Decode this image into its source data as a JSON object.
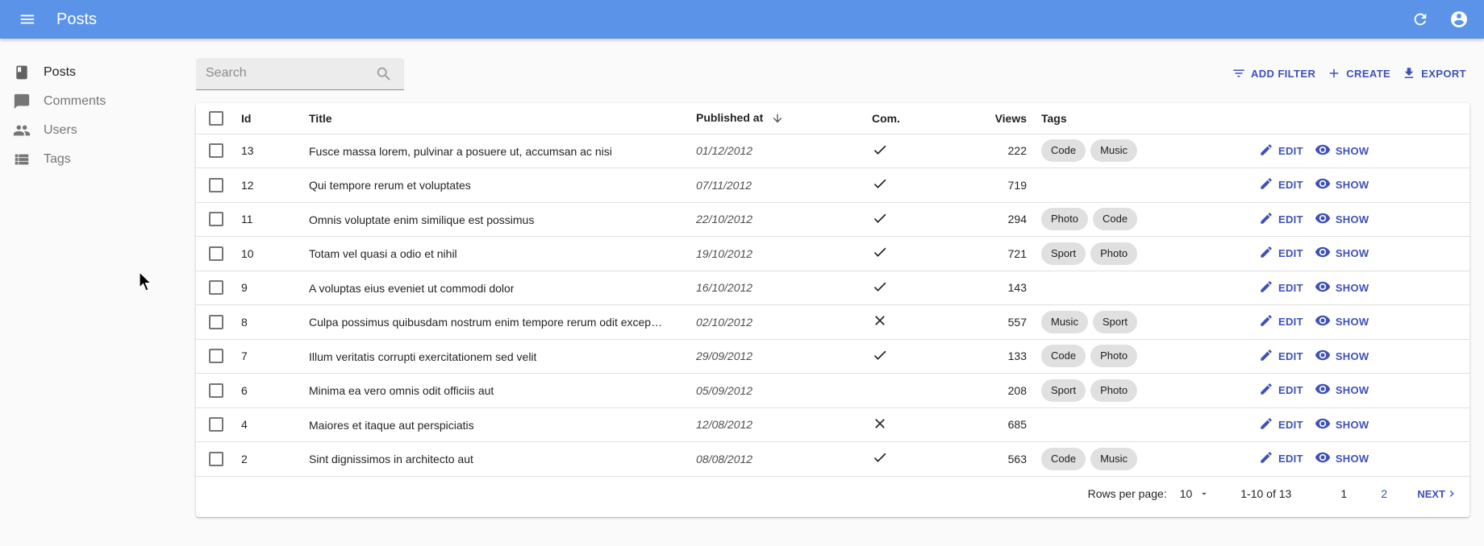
{
  "appbar": {
    "title": "Posts",
    "accent": "#5a93e8"
  },
  "sidebar": {
    "items": [
      {
        "label": "Posts",
        "icon": "book-icon"
      },
      {
        "label": "Comments",
        "icon": "comment-icon"
      },
      {
        "label": "Users",
        "icon": "people-icon"
      },
      {
        "label": "Tags",
        "icon": "list-icon"
      }
    ]
  },
  "search": {
    "placeholder": "Search",
    "value": ""
  },
  "toolbar": {
    "add_filter": "ADD FILTER",
    "create": "CREATE",
    "export": "EXPORT"
  },
  "table": {
    "headers": {
      "id": "Id",
      "title": "Title",
      "published_at": "Published at",
      "com": "Com.",
      "views": "Views",
      "tags": "Tags"
    },
    "action_edit": "EDIT",
    "action_show": "SHOW",
    "rows": [
      {
        "id": "13",
        "title": "Fusce massa lorem, pulvinar a posuere ut, accumsan ac nisi",
        "date": "01/12/2012",
        "com": "check",
        "views": "222",
        "tags": [
          "Code",
          "Music"
        ]
      },
      {
        "id": "12",
        "title": "Qui tempore rerum et voluptates",
        "date": "07/11/2012",
        "com": "check",
        "views": "719",
        "tags": []
      },
      {
        "id": "11",
        "title": "Omnis voluptate enim similique est possimus",
        "date": "22/10/2012",
        "com": "check",
        "views": "294",
        "tags": [
          "Photo",
          "Code"
        ]
      },
      {
        "id": "10",
        "title": "Totam vel quasi a odio et nihil",
        "date": "19/10/2012",
        "com": "check",
        "views": "721",
        "tags": [
          "Sport",
          "Photo"
        ]
      },
      {
        "id": "9",
        "title": "A voluptas eius eveniet ut commodi dolor",
        "date": "16/10/2012",
        "com": "check",
        "views": "143",
        "tags": []
      },
      {
        "id": "8",
        "title": "Culpa possimus quibusdam nostrum enim tempore rerum odit excepturi",
        "date": "02/10/2012",
        "com": "cross",
        "views": "557",
        "tags": [
          "Music",
          "Sport"
        ]
      },
      {
        "id": "7",
        "title": "Illum veritatis corrupti exercitationem sed velit",
        "date": "29/09/2012",
        "com": "check",
        "views": "133",
        "tags": [
          "Code",
          "Photo"
        ]
      },
      {
        "id": "6",
        "title": "Minima ea vero omnis odit officiis aut",
        "date": "05/09/2012",
        "com": "none",
        "views": "208",
        "tags": [
          "Sport",
          "Photo"
        ]
      },
      {
        "id": "4",
        "title": "Maiores et itaque aut perspiciatis",
        "date": "12/08/2012",
        "com": "cross",
        "views": "685",
        "tags": []
      },
      {
        "id": "2",
        "title": "Sint dignissimos in architecto aut",
        "date": "08/08/2012",
        "com": "check",
        "views": "563",
        "tags": [
          "Code",
          "Music"
        ]
      }
    ]
  },
  "pagination": {
    "rows_per_page_label": "Rows per page:",
    "rows_per_page": "10",
    "range": "1-10 of 13",
    "pages": [
      "1",
      "2"
    ],
    "next": "NEXT"
  }
}
